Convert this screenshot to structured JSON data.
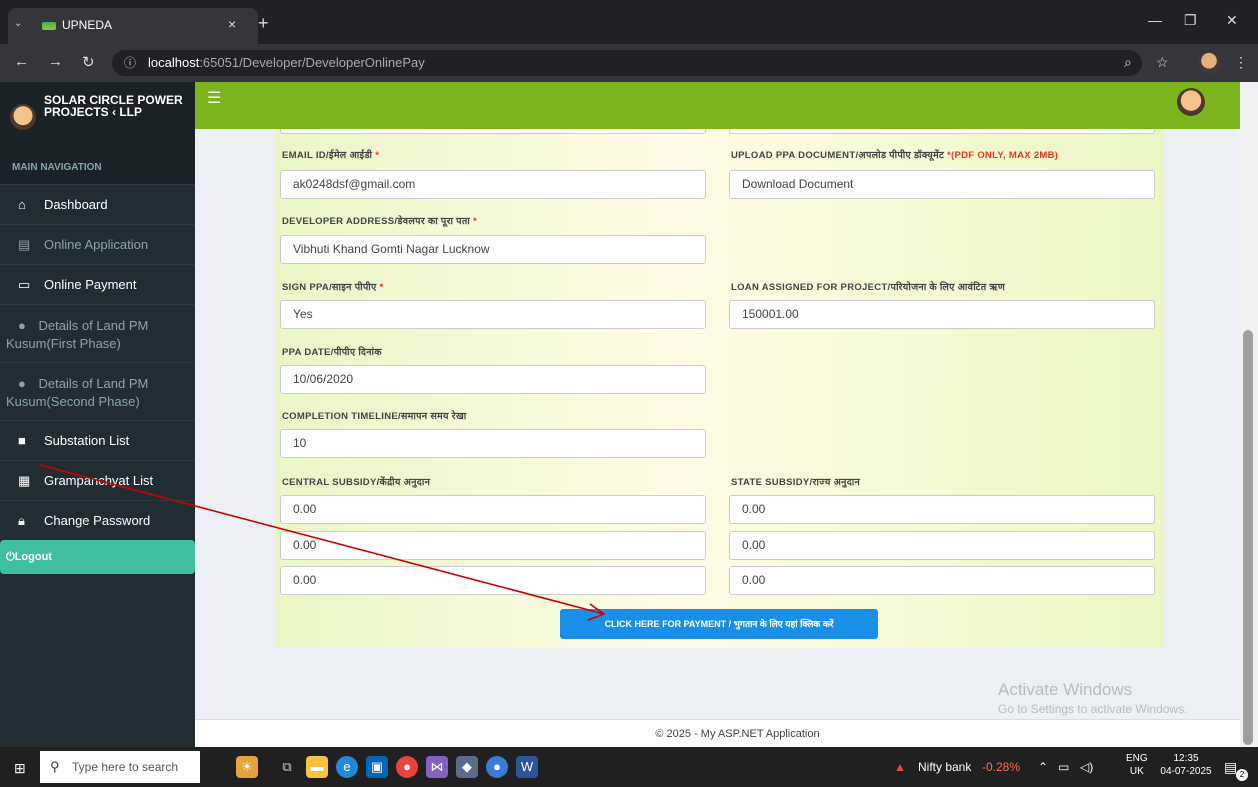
{
  "browser": {
    "tab_title": "UPNEDA",
    "tab_close": "×",
    "new_tab": "+",
    "url_host": "localhost",
    "url_rest": ":65051/Developer/DeveloperOnlinePay"
  },
  "sidebar": {
    "brand_name": "SOLAR CIRCLE POWER PROJECTS ‹ LLP",
    "nav_header": "MAIN NAVIGATION",
    "items": [
      {
        "label": "Dashboard",
        "icon": "home-icon"
      },
      {
        "label": "Online Application",
        "icon": "document-icon"
      },
      {
        "label": "Online Payment",
        "icon": "credit-card-icon"
      },
      {
        "label": "Details of Land PM Kusum(First Phase)",
        "icon": "map-marker-icon"
      },
      {
        "label": "Details of Land PM Kusum(Second Phase)",
        "icon": "map-marker-icon"
      },
      {
        "label": "Substation List",
        "icon": "building-icon"
      },
      {
        "label": "Grampanchyat List",
        "icon": "calculator-icon"
      },
      {
        "label": "Change Password",
        "icon": "lock-icon"
      }
    ],
    "logout": "Logout"
  },
  "form": {
    "email_label": "EMAIL ID/ईमेल आईडी",
    "email_value": "ak0248dsf@gmail.com",
    "upload_label": "UPLOAD PPA DOCUMENT/अपलोड पीपीए डॉक्यूमेंट",
    "upload_note": "*(PDF ONLY, MAX 2MB)",
    "upload_value": "Download Document",
    "address_label": "DEVELOPER ADDRESS/डेवलपर का पूरा पता",
    "address_value": "Vibhuti Khand Gomti Nagar Lucknow",
    "sign_label": "SIGN PPA/साइन पीपीए",
    "sign_value": "Yes",
    "loan_label": "LOAN ASSIGNED FOR PROJECT/परियोजना के लिए आवंटित ऋण",
    "loan_value": "150001.00",
    "ppa_date_label": "PPA DATE/पीपीए दिनांक",
    "ppa_date_value": "10/06/2020",
    "completion_label": "COMPLETION TIMELINE/समापन समय रेखा",
    "completion_value": "10",
    "central_label": "CENTRAL SUBSIDY/केंद्रीय अनुदान",
    "state_label": "STATE SUBSIDY/राज्य अनुदान",
    "central_values": [
      "0.00",
      "0.00",
      "0.00"
    ],
    "state_values": [
      "0.00",
      "0.00",
      "0.00"
    ],
    "required_mark": "*",
    "pay_button": "CLICK HERE FOR PAYMENT / भुगतान के लिए यहां क्लिक करें"
  },
  "watermark": {
    "line1": "Activate Windows",
    "line2": "Go to Settings to activate Windows."
  },
  "footer": "© 2025 - My ASP.NET Application",
  "taskbar": {
    "search_placeholder": "Type here to search",
    "ticker_name": "Nifty bank",
    "ticker_change": "-0.28%",
    "lang_top": "ENG",
    "lang_bottom": "UK",
    "time": "12:35",
    "date": "04-07-2025",
    "notif_count": "2"
  }
}
